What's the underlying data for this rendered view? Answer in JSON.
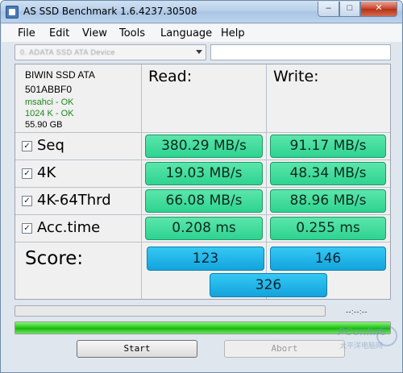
{
  "window": {
    "title": "AS SSD Benchmark 1.6.4237.30508",
    "minimize_glyph": "–",
    "maximize_glyph": "□",
    "close_glyph": "✕"
  },
  "menu": [
    "File",
    "Edit",
    "View",
    "Tools",
    "Language",
    "Help"
  ],
  "drive_select": {
    "value": "0. ADATA SSD ATA Device"
  },
  "drive_info": {
    "name": "BIWIN SSD ATA",
    "firmware": "501ABBF0",
    "ahci_status": "msahci - OK",
    "alignment_status": "1024 K - OK",
    "size": "55.90 GB"
  },
  "columns": {
    "read": "Read:",
    "write": "Write:"
  },
  "tests": [
    {
      "label": "Seq",
      "checked": true,
      "read": "380.29 MB/s",
      "write": "91.17 MB/s"
    },
    {
      "label": "4K",
      "checked": true,
      "read": "19.03 MB/s",
      "write": "48.34 MB/s"
    },
    {
      "label": "4K-64Thrd",
      "checked": true,
      "read": "66.08 MB/s",
      "write": "88.96 MB/s"
    },
    {
      "label": "Acc.time",
      "checked": true,
      "read": "0.208 ms",
      "write": "0.255 ms"
    }
  ],
  "checkbox_glyph": "✓",
  "score": {
    "label": "Score:",
    "read": "123",
    "write": "146",
    "total": "326"
  },
  "progress": {
    "time_readout": "--:--:--",
    "test_progress_fraction": 0.0,
    "overall_progress_fraction": 1.0,
    "fill_color": "#1ec612"
  },
  "buttons": {
    "start": "Start",
    "abort": "Abort"
  },
  "watermark": {
    "logo": "PConline",
    "subtitle": "太平洋电脑网"
  },
  "colors": {
    "result_green": "#2ed391",
    "score_blue": "#13a4dc",
    "status_ok": "#1b8a1b"
  }
}
